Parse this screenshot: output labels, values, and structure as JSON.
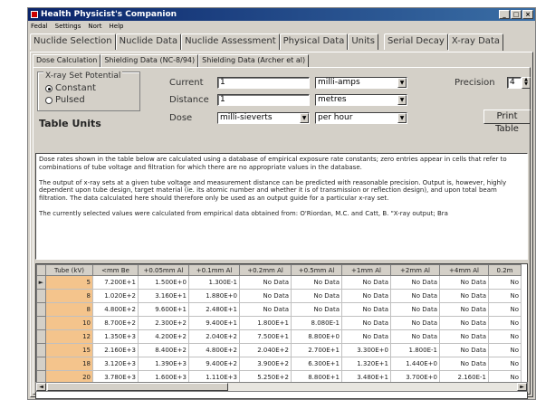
{
  "window": {
    "title": "Health Physicist's Companion",
    "menu": [
      "Fedal",
      "Settings",
      "Nort",
      "Help"
    ]
  },
  "main_tabs": [
    {
      "label": "Nuclide Selection",
      "active": false
    },
    {
      "label": "Nuclide Data",
      "active": false
    },
    {
      "label": "Nuclide Assessment",
      "active": false
    },
    {
      "label": "Physical Data",
      "active": false
    },
    {
      "label": "Units",
      "active": false
    },
    {
      "label": "Serial Decay",
      "active": false
    },
    {
      "label": "X-ray Data",
      "active": true
    }
  ],
  "sub_tabs": [
    {
      "label": "Dose Calculation",
      "active": true
    },
    {
      "label": "Shielding Data (NC-8/94)",
      "active": false
    },
    {
      "label": "Shielding Data (Archer et al)",
      "active": false
    }
  ],
  "xray_set": {
    "title": "X-ray Set Potential",
    "options": [
      {
        "label": "Constant",
        "selected": true
      },
      {
        "label": "Pulsed",
        "selected": false
      }
    ]
  },
  "table_units_label": "Table Units",
  "form": {
    "current_label": "Current",
    "current_value": "1",
    "current_unit": "milli-amps",
    "distance_label": "Distance",
    "distance_value": "1",
    "distance_unit": "metres",
    "dose_label": "Dose",
    "dose_unit": "milli-sieverts",
    "dose_rate_unit": "per hour",
    "precision_label": "Precision",
    "precision_value": "4",
    "print_button": "Print Table"
  },
  "description": [
    "Dose rates shown in the table below are calculated using a database of empirical exposure rate constants; zero entries appear in cells that refer to combinations of tube voltage and filtration for which there are no appropriate values in the database.",
    "The output of x-ray sets at a given tube voltage and measurement distance can be predicted with reasonable precision. Output is, however, highly dependent upon tube design, target material (ie. its atomic number and whether it is of transmission or reflection design), and upon total beam filtration. The data calculated here should therefore only be used as an output guide for a particular x-ray set.",
    "The currently selected values were calculated from empirical data obtained from: O'Riordan, M.C. and Catt, B. \"X-ray output; Bra"
  ],
  "grid": {
    "columns": [
      "Tube (kV)",
      "<mm Be",
      "+0.05mm Al",
      "+0.1mm Al",
      "+0.2mm Al",
      "+0.5mm Al",
      "+1mm Al",
      "+2mm Al",
      "+4mm Al",
      "0.2m"
    ],
    "rows": [
      [
        "5",
        "7.200E+1",
        "1.500E+0",
        "1.300E-1",
        "No Data",
        "No Data",
        "No Data",
        "No Data",
        "No Data",
        "No"
      ],
      [
        "8",
        "1.020E+2",
        "3.160E+1",
        "1.880E+0",
        "No Data",
        "No Data",
        "No Data",
        "No Data",
        "No Data",
        "No"
      ],
      [
        "8",
        "4.800E+2",
        "9.600E+1",
        "2.480E+1",
        "No Data",
        "No Data",
        "No Data",
        "No Data",
        "No Data",
        "No"
      ],
      [
        "10",
        "8.700E+2",
        "2.300E+2",
        "9.400E+1",
        "1.800E+1",
        "8.080E-1",
        "No Data",
        "No Data",
        "No Data",
        "No"
      ],
      [
        "12",
        "1.350E+3",
        "4.200E+2",
        "2.040E+2",
        "7.500E+1",
        "8.800E+0",
        "No Data",
        "No Data",
        "No Data",
        "No"
      ],
      [
        "15",
        "2.160E+3",
        "8.400E+2",
        "4.800E+2",
        "2.040E+2",
        "2.700E+1",
        "3.300E+0",
        "1.800E-1",
        "No Data",
        "No"
      ],
      [
        "18",
        "3.120E+3",
        "1.390E+3",
        "9.400E+2",
        "3.900E+2",
        "6.300E+1",
        "1.320E+1",
        "1.440E+0",
        "No Data",
        "No"
      ],
      [
        "20",
        "3.780E+3",
        "1.600E+3",
        "1.110E+3",
        "5.250E+2",
        "8.800E+1",
        "3.480E+1",
        "3.700E+0",
        "2.160E-1",
        "No"
      ]
    ],
    "selected_row": 0
  }
}
